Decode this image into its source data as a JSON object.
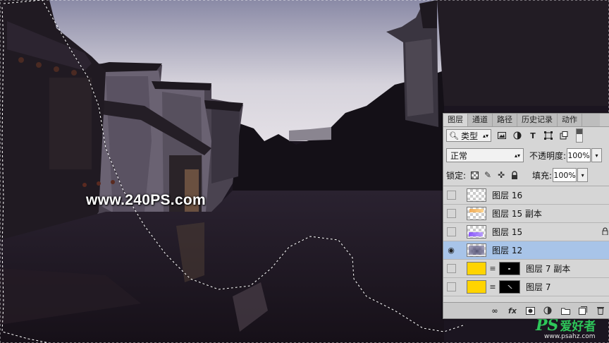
{
  "watermark": {
    "text": "www.240PS.com"
  },
  "logo": {
    "ps": "PS",
    "cn": "爱好者",
    "url": "www.psahz.com"
  },
  "layers_panel": {
    "tabs": [
      {
        "label": "图层",
        "active": true
      },
      {
        "label": "通道"
      },
      {
        "label": "路径"
      },
      {
        "label": "历史记录"
      },
      {
        "label": "动作"
      }
    ],
    "filter": {
      "icon": "search-icon",
      "value": "类型"
    },
    "filter_icons": [
      "image-filter-icon",
      "adjustment-filter-icon",
      "type-filter-icon",
      "shape-filter-icon",
      "smart-object-filter-icon"
    ],
    "blend_mode": "正常",
    "opacity_label": "不透明度:",
    "opacity_value": "100%",
    "lock_label": "锁定:",
    "lock_icons": [
      "lock-transparent-icon",
      "lock-paint-icon",
      "lock-position-icon",
      "lock-all-icon"
    ],
    "fill_label": "填充:",
    "fill_value": "100%",
    "layers": [
      {
        "name": "图层 16",
        "visible": false,
        "thumb": "transparent"
      },
      {
        "name": "图层 15 副本",
        "visible": false,
        "thumb": "transparent-orange"
      },
      {
        "name": "图层 15",
        "visible": false,
        "thumb": "transparent-purple",
        "locked": true
      },
      {
        "name": "图层 12",
        "visible": true,
        "selected": true,
        "thumb": "transparent-dark"
      },
      {
        "name": "图层 7 副本",
        "visible": false,
        "thumb": "yellow",
        "mask": true
      },
      {
        "name": "图层 7",
        "visible": false,
        "thumb": "yellow",
        "mask": true
      }
    ],
    "bottom_buttons": [
      "link-layers-icon",
      "fx-icon",
      "add-mask-icon",
      "adjustment-layer-icon",
      "new-group-icon",
      "new-layer-icon",
      "delete-icon"
    ],
    "bottom_labels": {
      "fx": "fx"
    }
  },
  "colors": {
    "selected_row": "#a8c4e8",
    "panel_bg": "#d6d6d6",
    "accent_yellow": "#ffd400"
  }
}
